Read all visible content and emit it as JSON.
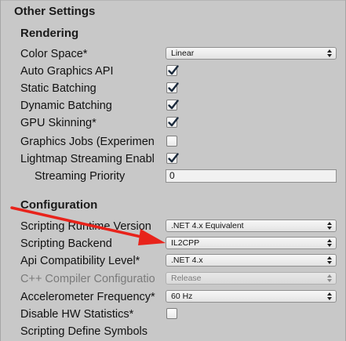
{
  "header": {
    "title": "Other Settings"
  },
  "rendering": {
    "title": "Rendering",
    "color_space": {
      "label": "Color Space*",
      "value": "Linear"
    },
    "auto_graphics_api": {
      "label": "Auto Graphics API",
      "checked": true
    },
    "static_batching": {
      "label": "Static Batching",
      "checked": true
    },
    "dynamic_batching": {
      "label": "Dynamic Batching",
      "checked": true
    },
    "gpu_skinning": {
      "label": "GPU Skinning*",
      "checked": true
    },
    "graphics_jobs": {
      "label": "Graphics Jobs (Experimen",
      "checked": false
    },
    "lightmap_streaming": {
      "label": "Lightmap Streaming Enabl",
      "checked": true
    },
    "streaming_priority": {
      "label": "Streaming Priority",
      "value": "0"
    }
  },
  "configuration": {
    "title": "Configuration",
    "scripting_runtime": {
      "label": "Scripting Runtime Version",
      "value": ".NET 4.x Equivalent"
    },
    "scripting_backend": {
      "label": "Scripting Backend",
      "value": "IL2CPP"
    },
    "api_compat": {
      "label": "Api Compatibility Level*",
      "value": ".NET 4.x"
    },
    "cpp_compiler": {
      "label": "C++ Compiler Configuratio",
      "value": "Release"
    },
    "accelerometer": {
      "label": "Accelerometer Frequency*",
      "value": "60 Hz"
    },
    "disable_hw_stats": {
      "label": "Disable HW Statistics*",
      "checked": false
    },
    "define_symbols": {
      "label": "Scripting Define Symbols"
    }
  },
  "annotation": {
    "color": "#e8231b"
  }
}
